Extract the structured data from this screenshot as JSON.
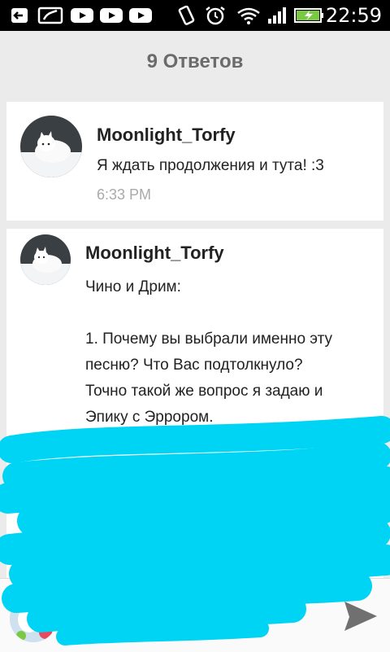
{
  "status_bar": {
    "time": "22:59",
    "icons": [
      "back-arrow-icon",
      "picture-icon",
      "youtube-icon",
      "youtube-icon",
      "youtube-icon",
      "vibrate-icon",
      "alarm-icon",
      "wifi-icon",
      "signal-icon",
      "battery-charging-icon"
    ]
  },
  "header": {
    "title": "9 Ответов"
  },
  "replies": [
    {
      "author": "Moonlight_Torfy",
      "text": "Я ждать продолжения и тута! :3",
      "time": "6:33 PM"
    },
    {
      "author": "Moonlight_Torfy",
      "lines": [
        "Чино и Дрим:",
        "",
        "1. Почему вы выбрали именно эту",
        "песню? Что Вас подтолкнуло?",
        "Точно такой же вопрос я задаю и",
        "Эпику с Эррором."
      ]
    }
  ],
  "reply_bar": {
    "placeholder": ""
  },
  "colors": {
    "scribble": "#00d4f5",
    "background": "#ebebeb"
  }
}
